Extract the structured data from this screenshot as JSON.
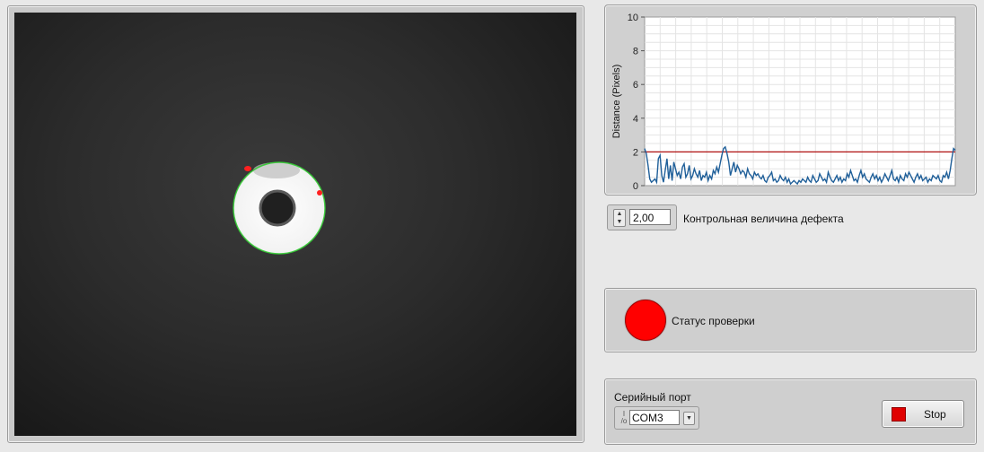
{
  "graph": {
    "y_axis_label": "Distance (Pixels)",
    "y_ticks": [
      "0",
      "2",
      "4",
      "6",
      "8",
      "10"
    ]
  },
  "chart_data": {
    "type": "line",
    "ylabel": "Distance (Pixels)",
    "ylim": [
      0,
      10
    ],
    "grid": true,
    "threshold": 2.0,
    "series": [
      {
        "values": [
          2.2,
          1.9,
          1.2,
          0.4,
          0.2,
          0.3,
          0.4,
          0.2,
          1.6,
          1.8,
          0.6,
          0.2,
          0.9,
          1.6,
          0.4,
          1.2,
          0.3,
          1.4,
          1.0,
          0.6,
          0.8,
          0.4,
          1.1,
          1.3,
          0.5,
          0.7,
          1.2,
          0.4,
          0.6,
          1.0,
          0.7,
          0.5,
          0.9,
          0.3,
          0.6,
          0.5,
          0.8,
          0.3,
          0.6,
          0.4,
          0.9,
          0.7,
          1.1,
          0.8,
          1.3,
          1.8,
          2.2,
          2.3,
          1.9,
          1.4,
          0.6,
          1.0,
          1.4,
          0.8,
          1.2,
          1.0,
          0.7,
          0.9,
          0.8,
          0.5,
          1.0,
          0.7,
          0.6,
          0.4,
          0.8,
          0.6,
          0.7,
          0.5,
          0.4,
          0.6,
          0.3,
          0.2,
          0.5,
          0.6,
          0.8,
          0.3,
          0.4,
          0.2,
          0.3,
          0.6,
          0.4,
          0.3,
          0.5,
          0.2,
          0.4,
          0.1,
          0.2,
          0.3,
          0.2,
          0.1,
          0.3,
          0.2,
          0.4,
          0.3,
          0.2,
          0.5,
          0.3,
          0.2,
          0.6,
          0.4,
          0.2,
          0.3,
          0.7,
          0.5,
          0.3,
          0.4,
          0.2,
          0.8,
          0.5,
          0.3,
          0.2,
          0.4,
          0.6,
          0.3,
          0.5,
          0.2,
          0.4,
          0.3,
          0.7,
          0.5,
          0.9,
          0.6,
          0.3,
          0.4,
          0.2,
          0.6,
          0.9,
          0.5,
          0.7,
          0.4,
          0.3,
          0.2,
          0.5,
          0.7,
          0.4,
          0.6,
          0.3,
          0.5,
          0.2,
          0.4,
          0.7,
          0.5,
          0.3,
          0.6,
          0.9,
          0.4,
          0.3,
          0.5,
          0.2,
          0.6,
          0.4,
          0.3,
          0.7,
          0.5,
          0.8,
          0.6,
          0.4,
          0.2,
          0.5,
          0.7,
          0.4,
          0.6,
          0.3,
          0.4,
          0.5,
          0.2,
          0.4,
          0.3,
          0.6,
          0.5,
          0.4,
          0.6,
          0.3,
          0.2,
          0.6,
          0.5,
          0.8,
          0.4,
          0.9,
          1.6,
          2.2,
          2.1
        ]
      }
    ]
  },
  "defect_threshold": {
    "value": "2,00",
    "label": "Контрольная величина дефекта"
  },
  "status": {
    "label": "Статус проверки",
    "led_color": "#ff0000"
  },
  "serial": {
    "label": "Серийный порт",
    "port_value": "COM3",
    "port_icon": "I/O"
  },
  "stop_button": {
    "label": "Stop",
    "indicator_color": "#e00000"
  },
  "colors": {
    "plot_line": "#1f5f99",
    "threshold_line": "#b01010",
    "edge_fit": "#33cc33",
    "defect_marker": "#ff2020"
  }
}
